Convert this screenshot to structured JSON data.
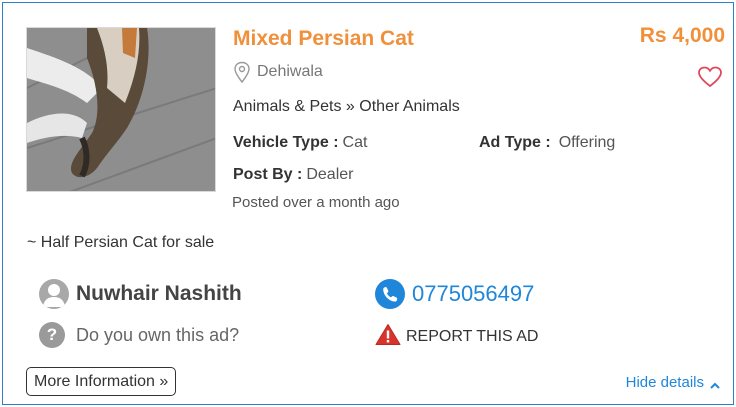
{
  "listing": {
    "title": "Mixed Persian Cat",
    "price": "Rs 4,000",
    "location": "Dehiwala",
    "category": "Animals & Pets » Other Animals",
    "vehicle_type_label": "Vehicle Type :",
    "vehicle_type_value": "Cat",
    "ad_type_label": "Ad Type :",
    "ad_type_value": "Offering",
    "post_by_label": "Post By :",
    "post_by_value": "Dealer",
    "posted": "Posted over a month ago",
    "description": "~ Half Persian Cat for sale"
  },
  "seller": {
    "name": "Nuwhair Nashith",
    "phone": "0775056497",
    "own_ad": "Do you own this ad?",
    "report": "REPORT THIS AD"
  },
  "actions": {
    "more_information": "More Information »",
    "hide_details": "Hide details"
  },
  "icons": {
    "location": "location-pin-icon",
    "favorite": "heart-icon",
    "avatar": "user-avatar-icon",
    "help": "question-icon",
    "phone": "phone-icon",
    "warning": "warning-icon",
    "chevron": "chevron-up-icon"
  },
  "colors": {
    "accent_orange": "#f0903b",
    "link_blue": "#1f86d9",
    "border_blue": "#2f7fc1",
    "warning_red": "#d9342b"
  }
}
